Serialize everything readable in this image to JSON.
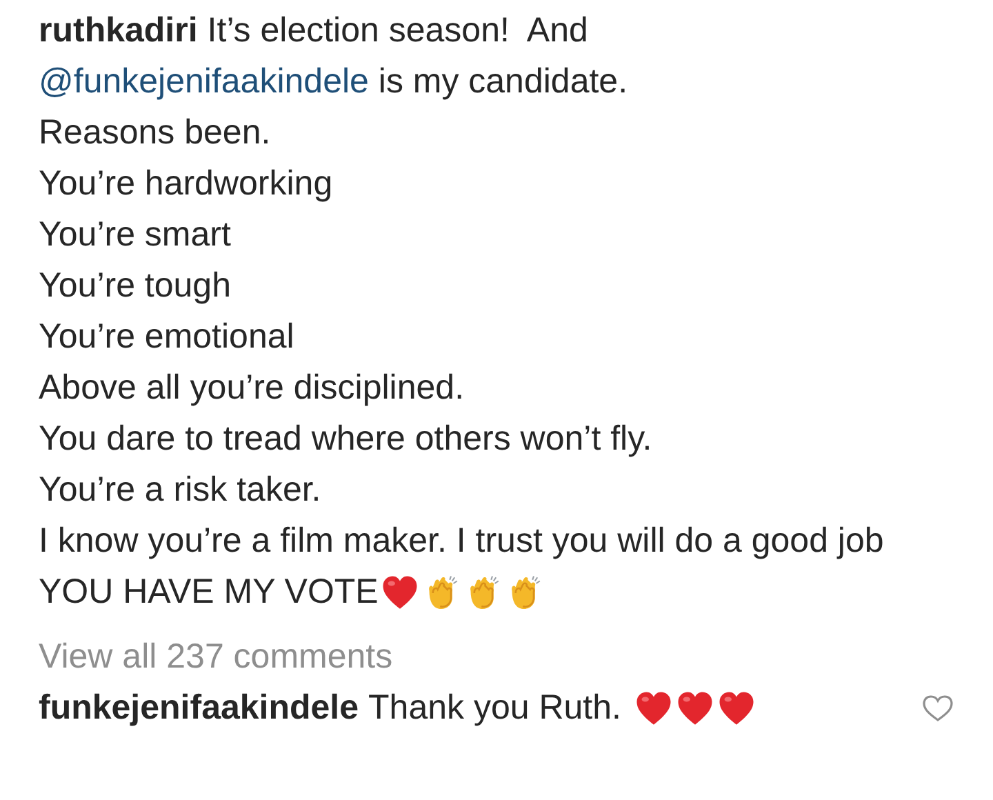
{
  "caption": {
    "username": "ruthkadiri",
    "first_text": "It’s election season!  And",
    "mention": "@funkejenifaakindele",
    "mention_text": " is my candidate.",
    "lines": [
      "Reasons been.",
      "You’re hardworking",
      "You’re smart",
      "You’re tough",
      "You’re emotional",
      "Above all you’re disciplined.",
      "You dare to tread where others won’t fly.",
      "You’re a risk taker.",
      "I know you’re a film maker. I trust you will do a good job"
    ],
    "last_text": "YOU HAVE MY VOTE",
    "last_emojis": [
      {
        "kind": "heart"
      },
      {
        "kind": "clap"
      },
      {
        "kind": "clap"
      },
      {
        "kind": "clap"
      }
    ]
  },
  "view_comments": "View all 237 comments",
  "comment": {
    "username": "funkejenifaakindele",
    "text": "Thank you Ruth.",
    "emojis": [
      {
        "kind": "heart"
      },
      {
        "kind": "heart"
      },
      {
        "kind": "heart"
      }
    ],
    "liked": false
  }
}
